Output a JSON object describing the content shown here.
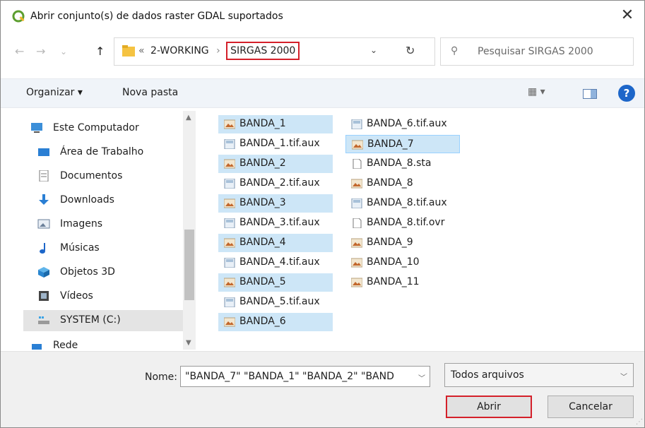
{
  "window": {
    "title": "Abrir conjunto(s) de dados raster GDAL suportados",
    "close_glyph": "✕"
  },
  "address": {
    "crumb_overflow": "«",
    "crumbs": [
      "2-WORKING",
      "SIRGAS 2000"
    ],
    "crumb_separator": "›",
    "search_placeholder": "Pesquisar SIRGAS 2000"
  },
  "nav_buttons": {
    "back": "←",
    "forward": "→",
    "recent": "⌄",
    "up": "↑"
  },
  "toolbar": {
    "organize": "Organizar ▾",
    "new_folder": "Nova pasta",
    "view_glyph": "▦ ▾",
    "help": "?"
  },
  "sidebar": {
    "items": [
      {
        "label": "Este Computador",
        "icon": "computer-icon"
      },
      {
        "label": "Área de Trabalho",
        "icon": "desktop-icon"
      },
      {
        "label": "Documentos",
        "icon": "documents-icon"
      },
      {
        "label": "Downloads",
        "icon": "downloads-icon"
      },
      {
        "label": "Imagens",
        "icon": "pictures-icon"
      },
      {
        "label": "Músicas",
        "icon": "music-icon"
      },
      {
        "label": "Objetos 3D",
        "icon": "objects-3d-icon"
      },
      {
        "label": "Vídeos",
        "icon": "videos-icon"
      },
      {
        "label": "SYSTEM (C:)",
        "icon": "drive-icon"
      },
      {
        "label": "Rede",
        "icon": "network-icon"
      }
    ],
    "selected": "SYSTEM (C:)"
  },
  "files": {
    "column1": [
      {
        "name": "BANDA_1",
        "type": "raster",
        "selected": true
      },
      {
        "name": "BANDA_1.tif.aux",
        "type": "aux",
        "selected": false
      },
      {
        "name": "BANDA_2",
        "type": "raster",
        "selected": true
      },
      {
        "name": "BANDA_2.tif.aux",
        "type": "aux",
        "selected": false
      },
      {
        "name": "BANDA_3",
        "type": "raster",
        "selected": true
      },
      {
        "name": "BANDA_3.tif.aux",
        "type": "aux",
        "selected": false
      },
      {
        "name": "BANDA_4",
        "type": "raster",
        "selected": true
      },
      {
        "name": "BANDA_4.tif.aux",
        "type": "aux",
        "selected": false
      },
      {
        "name": "BANDA_5",
        "type": "raster",
        "selected": true
      },
      {
        "name": "BANDA_5.tif.aux",
        "type": "aux",
        "selected": false
      },
      {
        "name": "BANDA_6",
        "type": "raster",
        "selected": true
      }
    ],
    "column2": [
      {
        "name": "BANDA_6.tif.aux",
        "type": "aux",
        "selected": false
      },
      {
        "name": "BANDA_7",
        "type": "raster",
        "selected": true,
        "focused": true
      },
      {
        "name": "BANDA_8.sta",
        "type": "blank",
        "selected": false
      },
      {
        "name": "BANDA_8",
        "type": "raster",
        "selected": false
      },
      {
        "name": "BANDA_8.tif.aux",
        "type": "aux",
        "selected": false
      },
      {
        "name": "BANDA_8.tif.ovr",
        "type": "blank",
        "selected": false
      },
      {
        "name": "BANDA_9",
        "type": "raster",
        "selected": false
      },
      {
        "name": "BANDA_10",
        "type": "raster",
        "selected": false
      },
      {
        "name": "BANDA_11",
        "type": "raster",
        "selected": false
      }
    ]
  },
  "footer": {
    "name_label": "Nome:",
    "name_value": "\"BANDA_7\" \"BANDA_1\" \"BANDA_2\" \"BAND",
    "filetype_value": "Todos arquivos",
    "open_button": "Abrir",
    "cancel_button": "Cancelar"
  },
  "colors": {
    "selection": "#cde6f7",
    "highlight_box": "#d4202a",
    "accent": "#1d66c9"
  }
}
